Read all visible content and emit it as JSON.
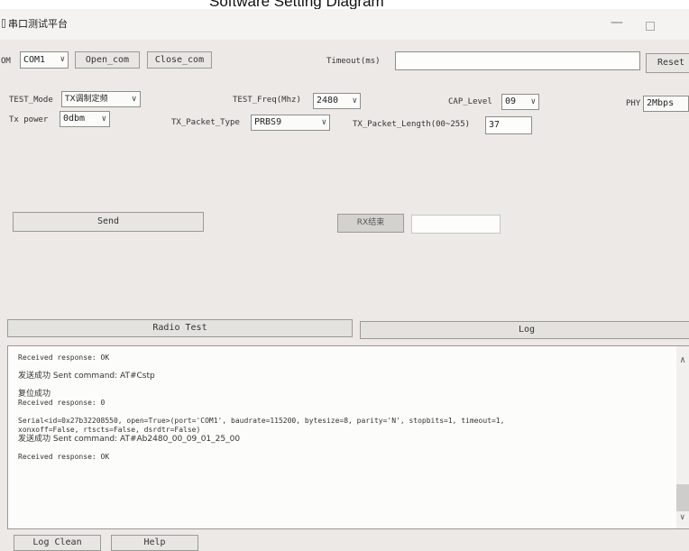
{
  "caption": "Software Setting Diagram",
  "window": {
    "title": "串口测试平台",
    "minimize_glyph": "—"
  },
  "toolbar": {
    "com_prefix": "OM",
    "com_port": "COM1",
    "open_label": "Open_com",
    "close_label": "Close_com",
    "timeout_label": "Timeout(ms)",
    "timeout_value": "",
    "reset_label": "Reset"
  },
  "settings": {
    "test_mode_label": "TEST_Mode",
    "test_mode_value": "TX调制定频",
    "test_freq_label": "TEST_Freq(Mhz)",
    "test_freq_value": "2480",
    "cap_level_label": "CAP_Level",
    "cap_level_value": "09",
    "phy_label": "PHY",
    "phy_value": "2Mbps",
    "tx_power_label": "Tx power",
    "tx_power_value": "0dbm",
    "tx_packet_type_label": "TX_Packet_Type",
    "tx_packet_type_value": "PRBS9",
    "tx_packet_length_label": "TX_Packet_Length(00~255)",
    "tx_packet_length_value": "37"
  },
  "actions": {
    "send_label": "Send",
    "rx_end_label": "RX结束",
    "rx_value": ""
  },
  "tabs": {
    "radio_test": "Radio Test",
    "log": "Log"
  },
  "log": {
    "lines": [
      "Received response: OK",
      "发送成功 Sent command: AT#Cstp",
      "复位成功",
      "Received response: 0",
      "Serial<id=0x27b32208550, open=True>(port='COM1', baudrate=115200, bytesize=8, parity='N', stopbits=1, timeout=1,",
      "xonxoff=False, rtscts=False, dsrdtr=False)",
      "发送成功 Sent command: AT#Ab2480_00_09_01_25_00",
      "Received response: OK"
    ]
  },
  "footer": {
    "log_clean_label": "Log Clean",
    "help_label": "Help"
  },
  "icons": {
    "dropdown": "chevron-down-icon",
    "scroll_up": "chevron-up-icon",
    "scroll_down": "chevron-down-icon"
  }
}
